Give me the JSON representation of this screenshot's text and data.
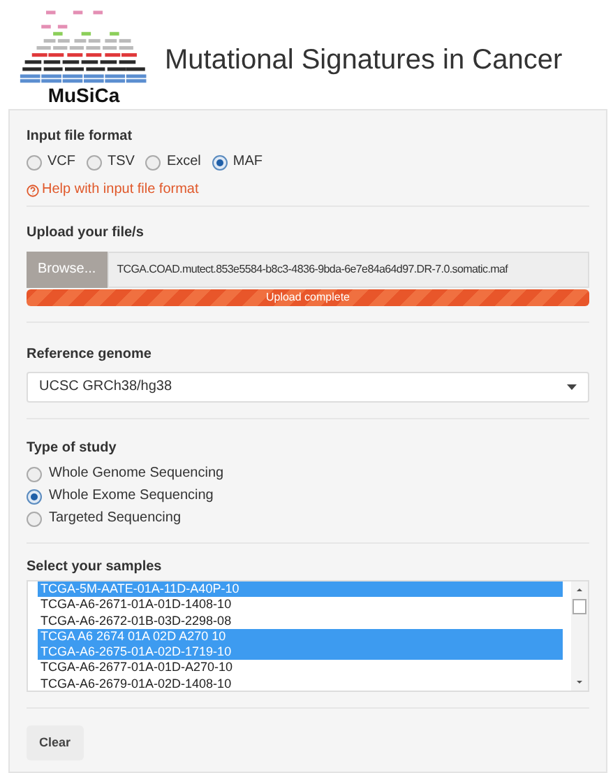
{
  "header": {
    "logo_text": "MuSiCa",
    "title": "Mutational Signatures in Cancer"
  },
  "input_format": {
    "label": "Input file format",
    "options": [
      {
        "label": "VCF",
        "selected": false
      },
      {
        "label": "TSV",
        "selected": false
      },
      {
        "label": "Excel",
        "selected": false
      },
      {
        "label": "MAF",
        "selected": true
      }
    ],
    "help_link": "Help with input file format"
  },
  "upload": {
    "label": "Upload your file/s",
    "browse_button": "Browse...",
    "file_name": "TCGA.COAD.mutect.853e5584-b8c3-4836-9bda-6e7e84a64d97.DR-7.0.somatic.maf",
    "progress": {
      "level": 1,
      "text": "Upload complete"
    }
  },
  "reference_genome": {
    "label": "Reference genome",
    "value": "UCSC GRCh38/hg38"
  },
  "study_type": {
    "label": "Type of study",
    "options": [
      {
        "label": "Whole Genome Sequencing",
        "selected": false
      },
      {
        "label": "Whole Exome Sequencing",
        "selected": true
      },
      {
        "label": "Targeted Sequencing",
        "selected": false
      }
    ]
  },
  "samples": {
    "label": "Select your samples",
    "items": [
      {
        "label": "TCGA-5M-AATE-01A-11D-A40P-10",
        "selected": true
      },
      {
        "label": "TCGA-A6-2671-01A-01D-1408-10",
        "selected": false
      },
      {
        "label": "TCGA-A6-2672-01B-03D-2298-08",
        "selected": false
      },
      {
        "label": "TCGA A6 2674 01A 02D A270 10",
        "selected": true
      },
      {
        "label": "TCGA-A6-2675-01A-02D-1719-10",
        "selected": true
      },
      {
        "label": "TCGA-A6-2677-01A-01D-A270-10",
        "selected": false
      },
      {
        "label": "TCGA-A6-2679-01A-02D-1408-10",
        "selected": false
      }
    ]
  },
  "clear_button": "Clear"
}
